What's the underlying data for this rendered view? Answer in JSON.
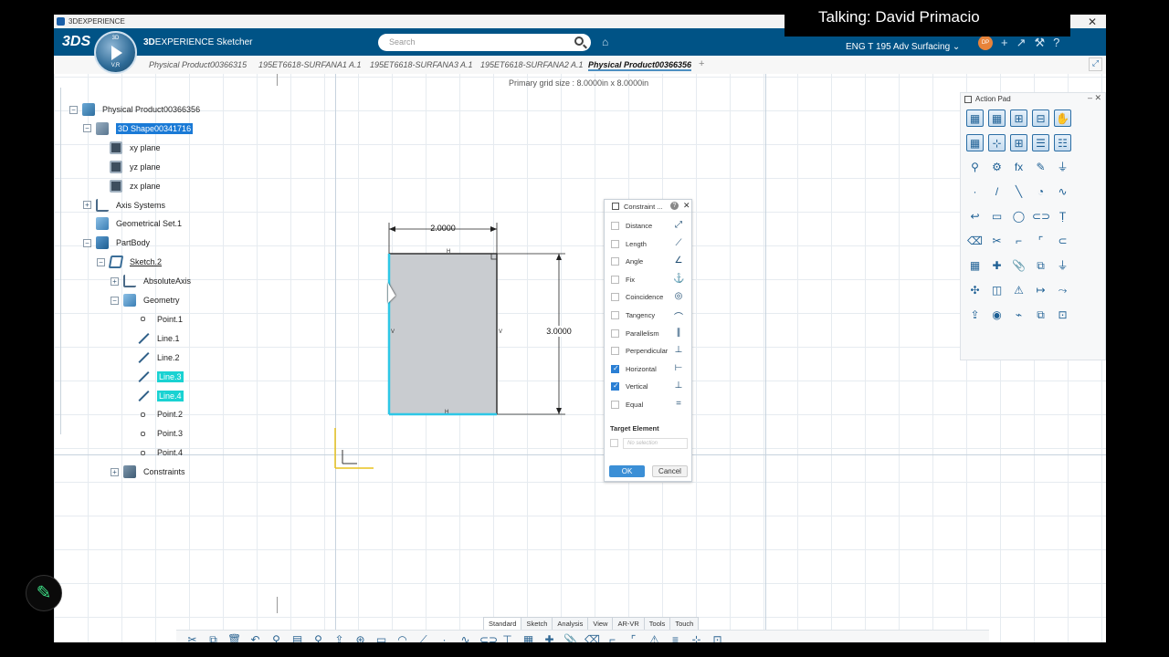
{
  "window": {
    "title": "3DEXPERIENCE",
    "close": "✕"
  },
  "topbar": {
    "logo": "3DS",
    "compass": {
      "north": "3D",
      "version": "V,R"
    },
    "app_title_bold": "3D",
    "app_title_rest": "EXPERIENCE Sketcher",
    "search_placeholder": "Search",
    "role": "ENG T 195 Adv Surfacing ⌄",
    "avatar": "DP",
    "icons": [
      "plus-icon",
      "share-icon",
      "tools-icon",
      "help-icon"
    ]
  },
  "tabs": [
    {
      "label": "Physical Product00366315",
      "active": false
    },
    {
      "label": "195ET6618-SURFANA1 A.1",
      "active": false
    },
    {
      "label": "195ET6618-SURFANA3 A.1",
      "active": false
    },
    {
      "label": "195ET6618-SURFANA2 A.1",
      "active": false
    },
    {
      "label": "Physical Product00366356",
      "active": true
    }
  ],
  "canvas": {
    "grid_info": "Primary grid size : 8.0000in x 8.0000in"
  },
  "tree": [
    {
      "label": "Physical Product00366356",
      "icon": "product-icon",
      "pm": "−",
      "state": ""
    },
    {
      "label": "3D Shape00341716",
      "icon": "shape-icon",
      "pm": "−",
      "state": "selected"
    },
    {
      "label": "xy plane",
      "icon": "plane-icon",
      "pm": "",
      "state": ""
    },
    {
      "label": "yz plane",
      "icon": "plane-icon",
      "pm": "",
      "state": ""
    },
    {
      "label": "zx plane",
      "icon": "plane-icon",
      "pm": "",
      "state": ""
    },
    {
      "label": "Axis Systems",
      "icon": "axis-icon",
      "pm": "+",
      "state": ""
    },
    {
      "label": "Geometrical Set.1",
      "icon": "geoset-icon",
      "pm": "",
      "state": ""
    },
    {
      "label": "PartBody",
      "icon": "body-icon",
      "pm": "−",
      "state": ""
    },
    {
      "label": "Sketch.2",
      "icon": "sketch-icon",
      "pm": "−",
      "state": "underline"
    },
    {
      "label": "AbsoluteAxis",
      "icon": "axis-icon",
      "pm": "+",
      "state": ""
    },
    {
      "label": "Geometry",
      "icon": "geometry-icon",
      "pm": "−",
      "state": ""
    },
    {
      "label": "Point.1",
      "icon": "point-icon",
      "pm": "",
      "state": ""
    },
    {
      "label": "Line.1",
      "icon": "line-icon",
      "pm": "",
      "state": ""
    },
    {
      "label": "Line.2",
      "icon": "line-icon",
      "pm": "",
      "state": ""
    },
    {
      "label": "Line.3",
      "icon": "line-icon",
      "pm": "",
      "state": "highlight"
    },
    {
      "label": "Line.4",
      "icon": "line-icon",
      "pm": "",
      "state": "highlight"
    },
    {
      "label": "Point.2",
      "icon": "point-icon",
      "pm": "",
      "state": ""
    },
    {
      "label": "Point.3",
      "icon": "point-icon",
      "pm": "",
      "state": ""
    },
    {
      "label": "Point.4",
      "icon": "point-icon",
      "pm": "",
      "state": ""
    },
    {
      "label": "Constraints",
      "icon": "constraints-icon",
      "pm": "+",
      "state": ""
    }
  ],
  "sketch": {
    "width_dim": "2.0000",
    "height_dim": "3.0000",
    "h_mark": "H",
    "v_mark": "V",
    "colors": {
      "fill": "#c9ccd0",
      "highlight": "#2ec7e6",
      "dim": "#222222",
      "axis": "#e8c21e"
    }
  },
  "constraint_dialog": {
    "title": "Constraint ...",
    "help": "?",
    "close": "✕",
    "items": [
      {
        "label": "Distance",
        "checked": false,
        "symbol": "⤢"
      },
      {
        "label": "Length",
        "checked": false,
        "symbol": "⟋"
      },
      {
        "label": "Angle",
        "checked": false,
        "symbol": "∠"
      },
      {
        "label": "Fix",
        "checked": false,
        "symbol": "⚓"
      },
      {
        "label": "Coincidence",
        "checked": false,
        "symbol": "◎"
      },
      {
        "label": "Tangency",
        "checked": false,
        "symbol": "⌒"
      },
      {
        "label": "Parallelism",
        "checked": false,
        "symbol": "∥"
      },
      {
        "label": "Perpendicular",
        "checked": false,
        "symbol": "⊥"
      },
      {
        "label": "Horizontal",
        "checked": true,
        "symbol": "⊢"
      },
      {
        "label": "Vertical",
        "checked": true,
        "symbol": "⊥"
      },
      {
        "label": "Equal",
        "checked": false,
        "symbol": "="
      }
    ],
    "target_label": "Target Element",
    "target_placeholder": "No selection",
    "ok": "OK",
    "cancel": "Cancel"
  },
  "action_pad": {
    "title": "Action Pad",
    "controls": "– ✕",
    "buttons": [
      "grid-icon",
      "snap-grid-icon",
      "toolbar-icon",
      "table-icon",
      "hand-icon",
      "grid2-icon",
      "snap-icon",
      "split-icon",
      "bars-icon",
      "list-icon",
      "zoom-icon",
      "robot-icon",
      "fx-icon",
      "pencil-icon",
      "plug-icon",
      "point-icon",
      "line-icon",
      "diag-line-icon",
      "arc3-icon",
      "spline-icon",
      "corner-icon",
      "rect-icon",
      "circle-icon",
      "slot-icon",
      "text-icon",
      "eraser-icon",
      "trim-icon",
      "fillet-icon",
      "chamfer-icon",
      "offset-icon",
      "grid3-icon",
      "add-icon",
      "clip-icon",
      "stack-icon",
      "plug2-icon",
      "move-icon",
      "mirror-icon",
      "cone-icon",
      "arrow-icon",
      "relimit-icon",
      "export-icon",
      "project-icon",
      "cut-icon",
      "stack2-icon",
      "frame-icon"
    ],
    "glyphs": [
      "▦",
      "▦",
      "⊞",
      "⊟",
      "✋",
      "▦",
      "⊹",
      "⊞",
      "☰",
      "☷",
      "⚲",
      "⚙",
      "fx",
      "✎",
      "⏚",
      "·",
      "/",
      "╲",
      "◔",
      "∿",
      "↩",
      "▭",
      "◯",
      "⊂⊃",
      "Ṭ",
      "⌫",
      "✂",
      "⌐",
      "⌜",
      "⊂",
      "▦",
      "✚",
      "📎",
      "⧉",
      "⏚",
      "✣",
      "◫",
      "⚠",
      "↦",
      "⤳",
      "⇪",
      "◉",
      "⌁",
      "⧉",
      "⊡"
    ]
  },
  "bottom_tabs": [
    {
      "label": "Standard",
      "active": true
    },
    {
      "label": "Sketch",
      "active": false
    },
    {
      "label": "Analysis",
      "active": false
    },
    {
      "label": "View",
      "active": false
    },
    {
      "label": "AR-VR",
      "active": false
    },
    {
      "label": "Tools",
      "active": false
    },
    {
      "label": "Touch",
      "active": false
    }
  ],
  "bottom_toolbar": [
    "✂",
    "⧉",
    "🗑",
    "↶",
    "⚲",
    "▤",
    "⚲",
    "⇪",
    "⊛",
    "▭",
    "◠",
    "⟋",
    "·",
    "∿",
    "⊂⊃",
    "⊤",
    "▦",
    "✚",
    "📎",
    "⌫",
    "⌐",
    "⌜",
    "⚠",
    "≡",
    "⊹",
    "⊡"
  ],
  "overlay": {
    "talking": "Talking: David Primacio",
    "pencil": "✎"
  }
}
